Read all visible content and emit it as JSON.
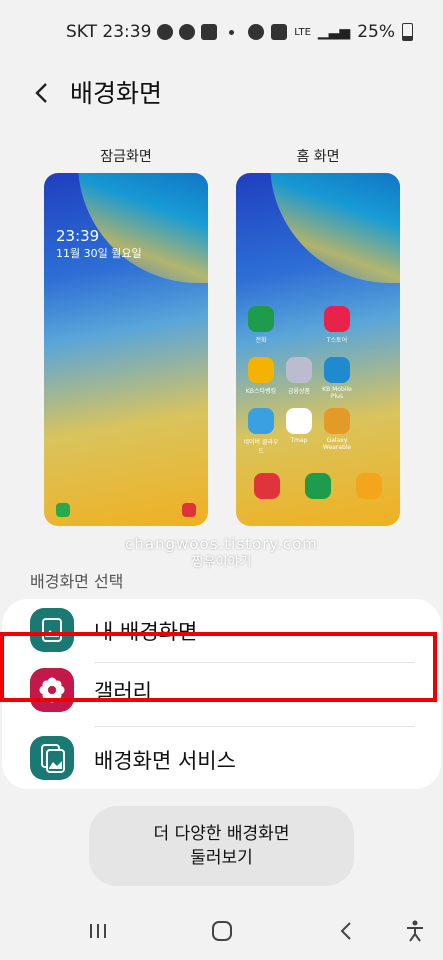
{
  "status_bar": {
    "carrier_time": "SKT 23:39",
    "network": "LTE",
    "battery": "25%"
  },
  "header": {
    "title": "배경화면"
  },
  "previews": {
    "lock_label": "잠금화면",
    "home_label": "홈 화면",
    "lock_time": "23:39",
    "lock_date": "11월 30일 월요일",
    "home_apps": [
      {
        "label": "전화"
      },
      {
        "label": "T스토어"
      },
      {
        "label": "KB스타뱅킹"
      },
      {
        "label": "금융상품"
      },
      {
        "label": "KB Mobile Plus"
      },
      {
        "label": "네이버 클라우드"
      },
      {
        "label": "Tmap"
      },
      {
        "label": "Galaxy Wearable"
      }
    ]
  },
  "watermark": {
    "line1": "changwoos.tistory.com",
    "line2": "짱우이야기"
  },
  "section": {
    "title": "배경화면 선택"
  },
  "menu": {
    "items": [
      {
        "label": "내 배경화면",
        "icon": "image-icon",
        "color": "#1a7a73"
      },
      {
        "label": "갤러리",
        "icon": "flower-icon",
        "color": "#c2184a"
      },
      {
        "label": "배경화면 서비스",
        "icon": "wallpaper-service-icon",
        "color": "#1a7a73"
      }
    ]
  },
  "more_button": {
    "line1": "더 다양한 배경화면",
    "line2": "둘러보기"
  },
  "colors": {
    "highlight": "#ee0000",
    "teal": "#1a7a73",
    "gallery": "#c2184a"
  }
}
